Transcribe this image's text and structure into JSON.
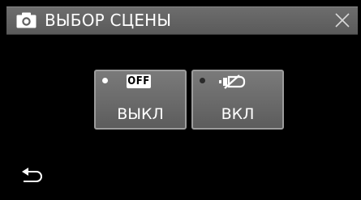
{
  "header": {
    "title": "ВЫБОР СЦЕНЫ",
    "mode_icon": "camera-icon",
    "close_icon": "close-icon"
  },
  "options": [
    {
      "badge": "OFF",
      "label": "ВЫКЛ",
      "selected": true,
      "icon": "off-icon"
    },
    {
      "badge": "",
      "label": "ВКЛ",
      "selected": false,
      "icon": "stabilizer-off-icon"
    }
  ],
  "footer": {
    "back_icon": "back-arrow-icon"
  },
  "colors": {
    "background": "#000000",
    "title_bar": "#5f5f5f",
    "button": "#6f6f6f",
    "button_border": "#9c9c9c",
    "text": "#ffffff"
  }
}
